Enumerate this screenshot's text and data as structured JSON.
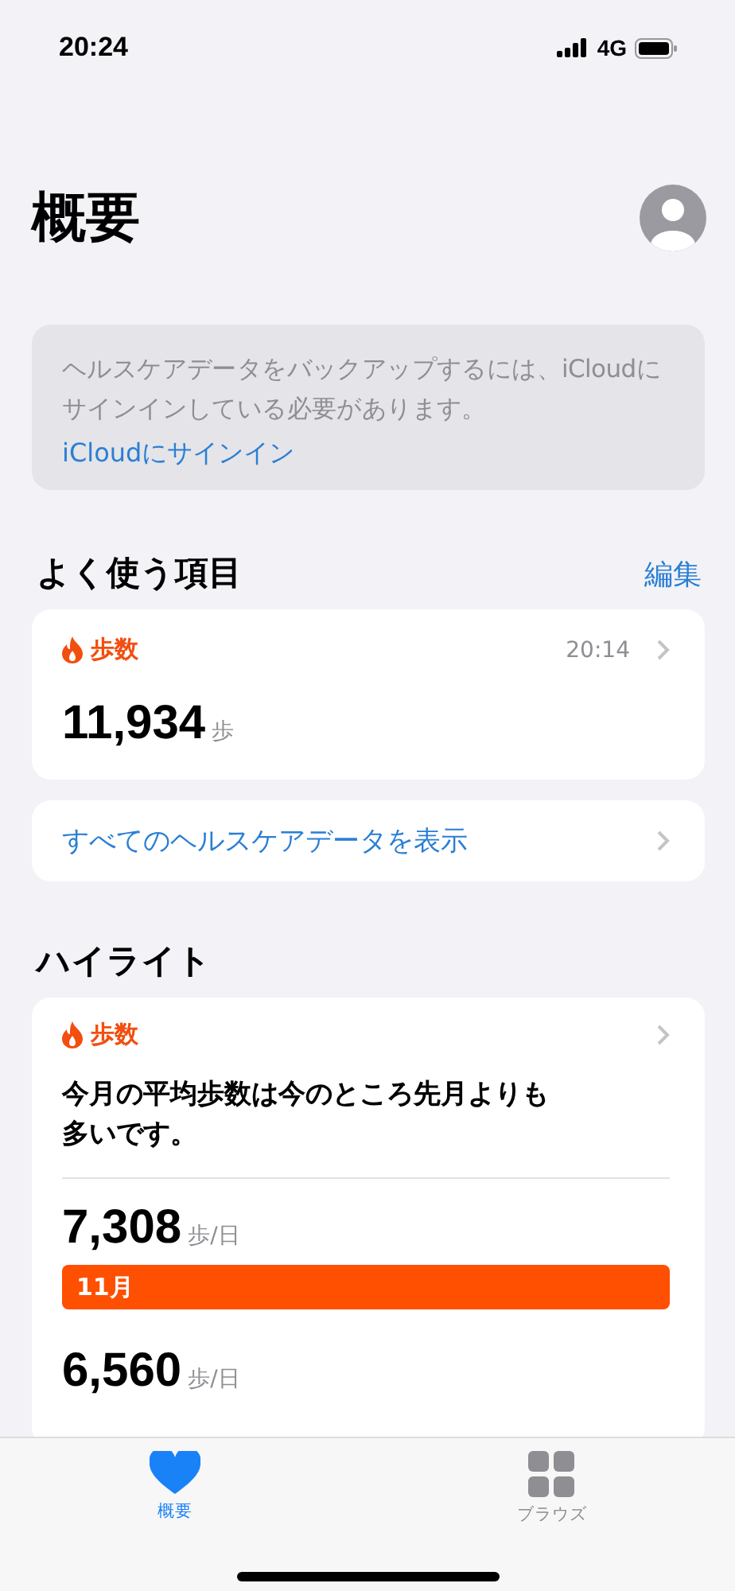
{
  "status_bar": {
    "time": "20:24",
    "network": "4G"
  },
  "title": "概要",
  "icloud_banner": {
    "message": "ヘルスケアデータをバックアップするには、iCloudにサインインしている必要があります。",
    "link": "iCloudにサインイン"
  },
  "favorites": {
    "heading": "よく使う項目",
    "edit": "編集",
    "card": {
      "category": "歩数",
      "time": "20:14",
      "value": "11,934",
      "unit": "歩"
    },
    "show_all": "すべてのヘルスケアデータを表示"
  },
  "highlights": {
    "heading": "ハイライト",
    "card": {
      "category": "歩数",
      "summary": "今月の平均歩数は今のところ先月よりも多いです。",
      "rows": [
        {
          "value": "7,308",
          "unit": "歩/日",
          "bar": {
            "label": "11月"
          }
        },
        {
          "value": "6,560",
          "unit": "歩/日"
        }
      ]
    }
  },
  "tab_bar": [
    {
      "label": "概要",
      "kind": "heart",
      "selected": true
    },
    {
      "label": "ブラウズ",
      "kind": "grid",
      "selected": false
    }
  ]
}
